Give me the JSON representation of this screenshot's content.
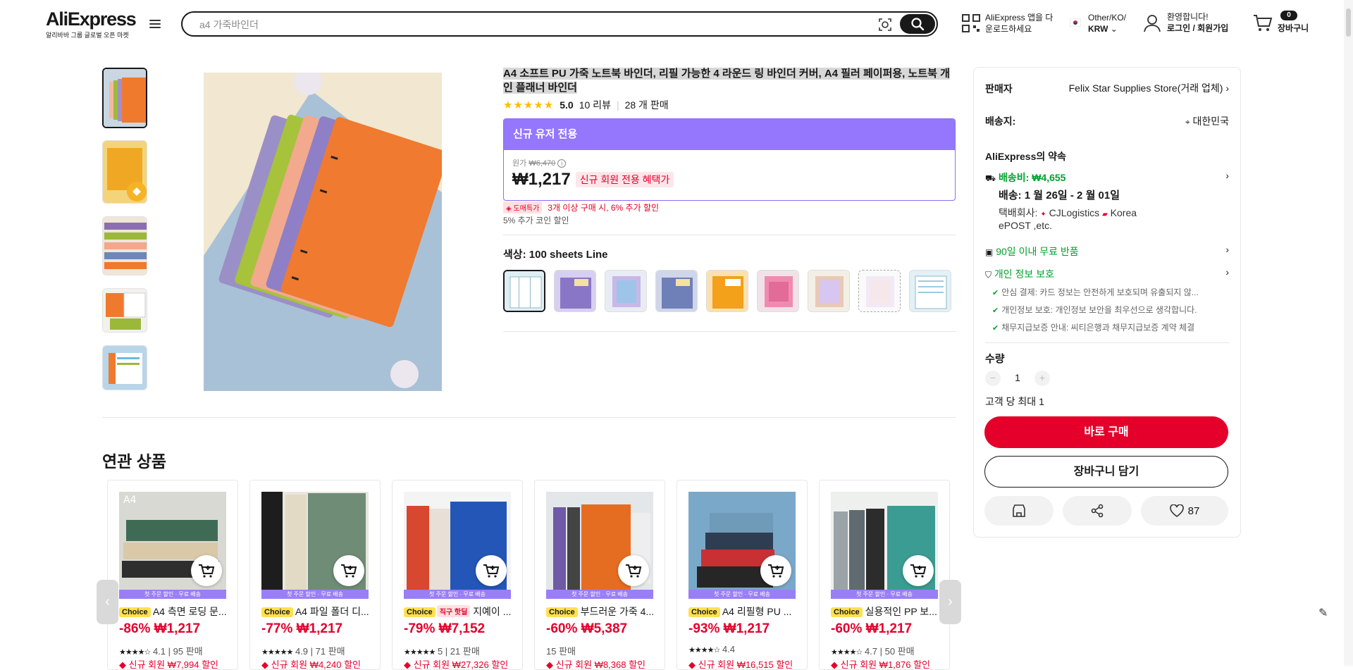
{
  "header": {
    "brand": "AliExpress",
    "brand_sub": "알리바바 그룹 글로벌 오픈 마켓",
    "search_placeholder": "a4 가죽바인더",
    "app_line1": "AliExpress 앱을 다",
    "app_line2": "운로드하세요",
    "region_line1": "Other/KO/",
    "region_line2": "KRW",
    "account_line1": "환영합니다!",
    "account_line2": "로그인 / 회원가입",
    "cart_count": "0",
    "cart_label": "장바구니"
  },
  "product": {
    "title": "A4 소프트 PU 가죽 노트북 바인더, 리필 가능한 4 라운드 링 바인더 커버, A4 필러 페이퍼용, 노트북 개인 플래너 바인더",
    "rating": "5.0",
    "reviews": "10 리뷰",
    "sold": "28 개 판매",
    "newuser_label": "신규 유저 전용",
    "original_label": "원가",
    "original_price": "₩6,470",
    "price": "₩1,217",
    "newuser_benefit": "신규 회원 전용 혜택가",
    "wholesale_badge": "도매특가",
    "wholesale_text": "3개 이상 구매 시, 6% 추가 할인",
    "coin_text": "5% 추가 코인 할인",
    "color_label": "색상:",
    "color_value": "100 sheets Line"
  },
  "panel": {
    "seller_label": "판매자",
    "seller_value": "Felix Star Supplies Store(거래 업체)",
    "ship_to_label": "배송지:",
    "ship_to_value": "대한민국",
    "promise_title": "AliExpress의 약속",
    "shipping_fee": "배송비: ₩4,655",
    "delivery": "배송: 1 월 26일 - 2 월 01일",
    "carrier_label": "택배회사:",
    "carrier1": "CJLogistics",
    "carrier2": "Korea",
    "carrier_rest": "ePOST ,etc.",
    "returns": "90일 이내 무료 반품",
    "privacy": "개인 정보 보호",
    "privacy_items": [
      "안심 결제: 카드 정보는 안전하게 보호되며 유출되지 않...",
      "개인정보 보호: 개인정보 보안을 최우선으로 생각합니다.",
      "채무지급보증 안내: 씨티은행과 채무지급보증 계약 체결"
    ],
    "qty_label": "수량",
    "qty_value": "1",
    "max_per_customer": "고객 당 최대 1",
    "buy_now": "바로 구매",
    "add_to_cart": "장바구니 담기",
    "wishlist_count": "87"
  },
  "related": {
    "heading": "연관 상품",
    "banner_text": "첫 주문 할인 · 무료 배송",
    "items": [
      {
        "badge": "Choice",
        "title": "A4 측면 로딩 문...",
        "price": "-86% ₩1,217",
        "rating": "4.1",
        "sold": "95 판매",
        "coupon": "신규 회원 ₩7,994 할인"
      },
      {
        "badge": "Choice",
        "title": "A4 파일 폴더 디...",
        "price": "-77% ₩1,217",
        "rating": "4.9",
        "sold": "71 판매",
        "coupon": "신규 회원 ₩4,240 할인"
      },
      {
        "badge": "Choice",
        "badge2": "직구 핫딜",
        "title": "지예이 ...",
        "price": "-79% ₩7,152",
        "rating": "5",
        "sold": "21 판매",
        "coupon": "신규 회원 ₩27,326 할인"
      },
      {
        "badge": "Choice",
        "title": "부드러운 가죽 4...",
        "price": "-60% ₩5,387",
        "rating": "",
        "sold": "15 판매",
        "coupon": "신규 회원 ₩8,368 할인"
      },
      {
        "badge": "Choice",
        "title": "A4 리필형 PU ...",
        "price": "-93% ₩1,217",
        "rating": "4.4",
        "sold": "",
        "coupon": "신규 회원 ₩16,515 할인"
      },
      {
        "badge": "Choice",
        "title": "실용적인 PP 보...",
        "price": "-60% ₩1,217",
        "rating": "4.7",
        "sold": "50 판매",
        "coupon": "신규 회원 ₩1,876 할인"
      }
    ]
  },
  "colors": {
    "accent_red": "#e4002b",
    "newuser_purple": "#9577fd",
    "green": "#00a02c",
    "star": "#fdbd00"
  }
}
